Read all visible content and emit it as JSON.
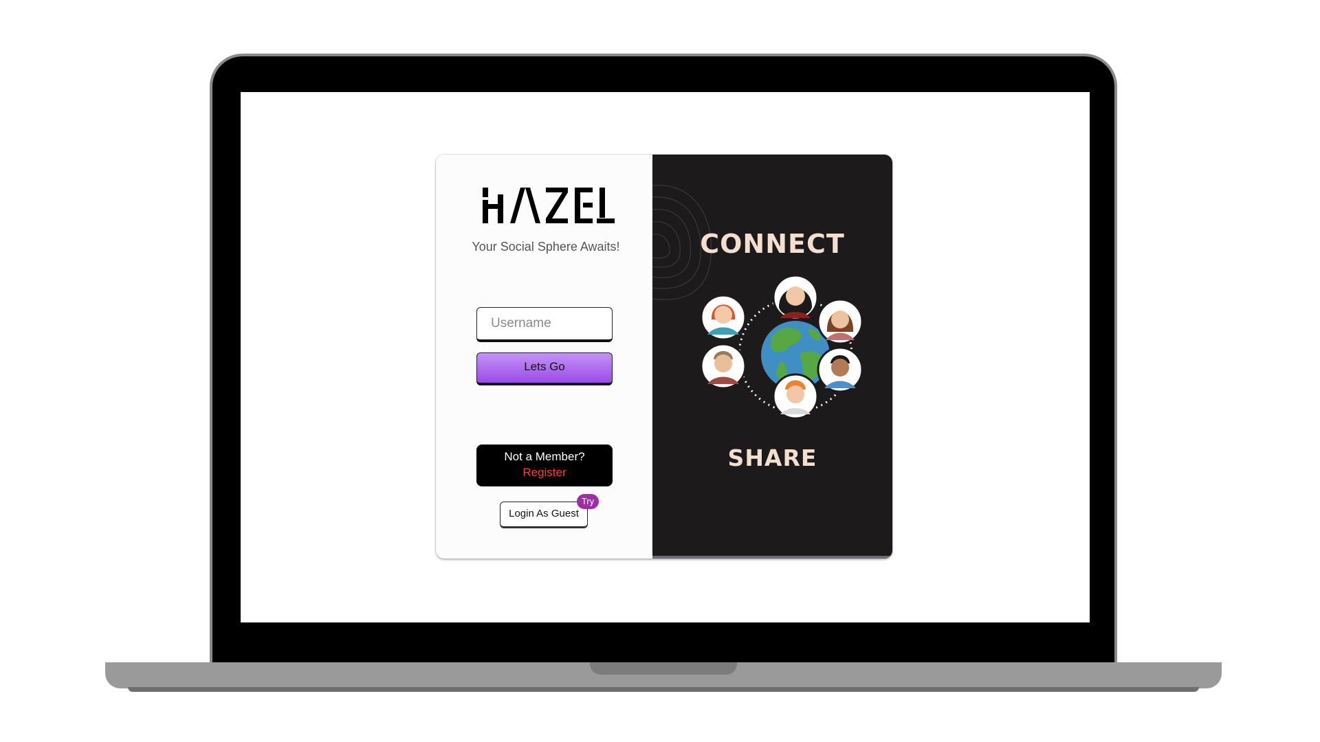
{
  "brand": {
    "logo_text": "HAZEL",
    "tagline": "Your Social Sphere Awaits!"
  },
  "form": {
    "username_placeholder": "Username",
    "username_value": "",
    "submit_label": "Lets Go"
  },
  "register": {
    "question": "Not a Member?",
    "link_label": "Register"
  },
  "guest": {
    "label": "Login As Guest",
    "badge": "Try"
  },
  "hero": {
    "top_heading": "CONNECT",
    "bottom_heading": "SHARE"
  },
  "colors": {
    "accent_purple": "#9b4be8",
    "register_red": "#ff3b3b",
    "badge_purple": "#9b2fa3",
    "dark_panel": "#1c1a1b",
    "heading_cream": "#f3dfcf"
  },
  "icons": [
    "globe-icon",
    "person-avatar-icon"
  ]
}
